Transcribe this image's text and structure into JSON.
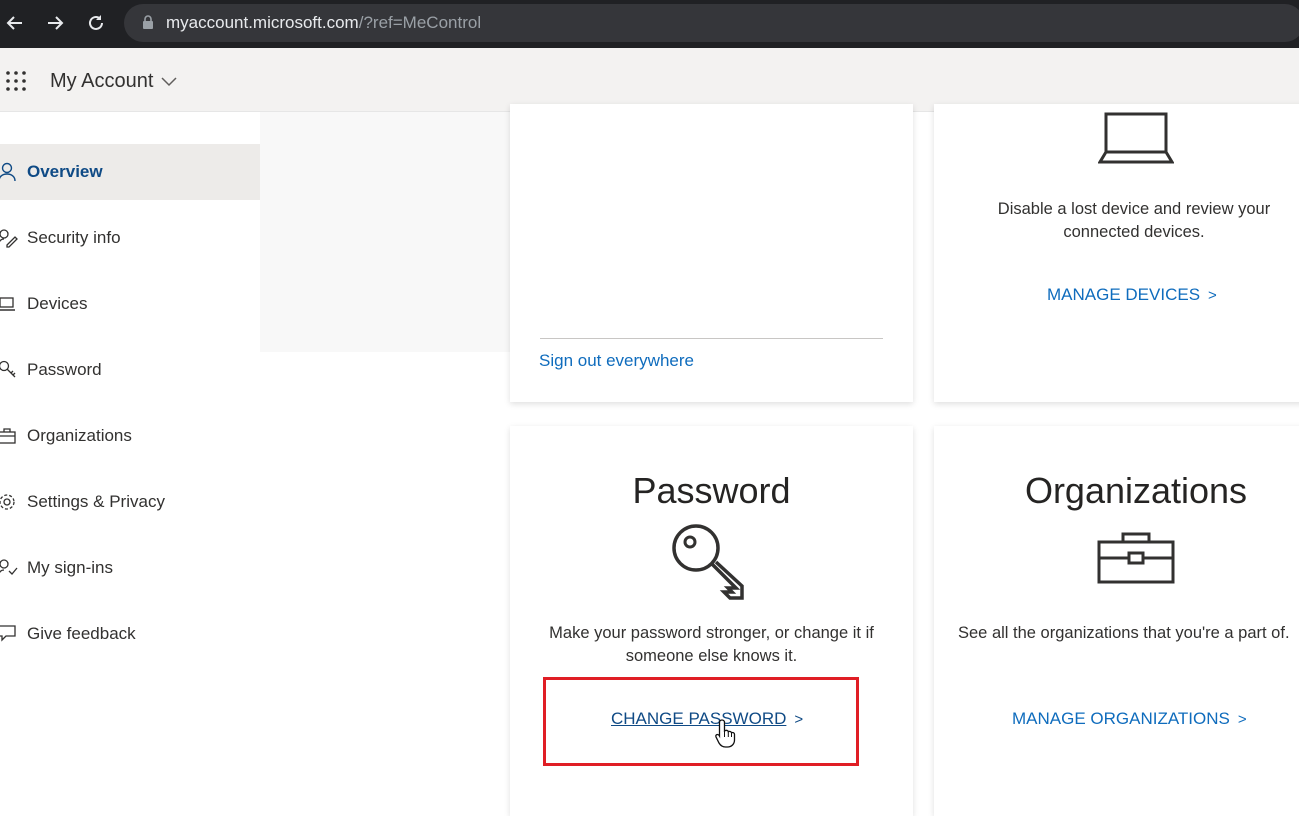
{
  "browser": {
    "url_host": "myaccount.microsoft.com",
    "url_path": "/?ref=MeControl"
  },
  "header": {
    "title": "My Account"
  },
  "sidebar": {
    "items": [
      {
        "label": "Overview",
        "icon": "person-icon",
        "active": true
      },
      {
        "label": "Security info",
        "icon": "security-info-icon"
      },
      {
        "label": "Devices",
        "icon": "laptop-icon"
      },
      {
        "label": "Password",
        "icon": "key-icon"
      },
      {
        "label": "Organizations",
        "icon": "briefcase-icon"
      },
      {
        "label": "Settings & Privacy",
        "icon": "gear-icon"
      },
      {
        "label": "My sign-ins",
        "icon": "sign-ins-icon"
      },
      {
        "label": "Give feedback",
        "icon": "feedback-icon"
      }
    ]
  },
  "cards": {
    "signout": {
      "link": "Sign out everywhere"
    },
    "devices": {
      "description": "Disable a lost device and review your connected devices.",
      "link": "MANAGE DEVICES"
    },
    "password": {
      "title": "Password",
      "description": "Make your password stronger, or change it if someone else knows it.",
      "link": "CHANGE PASSWORD"
    },
    "organizations": {
      "title": "Organizations",
      "description": "See all the organizations that you're a part of.",
      "link": "MANAGE ORGANIZATIONS"
    }
  },
  "colors": {
    "accent": "#0f6cbd",
    "highlight": "#e01e25",
    "active_nav_text": "#0f4a85"
  }
}
